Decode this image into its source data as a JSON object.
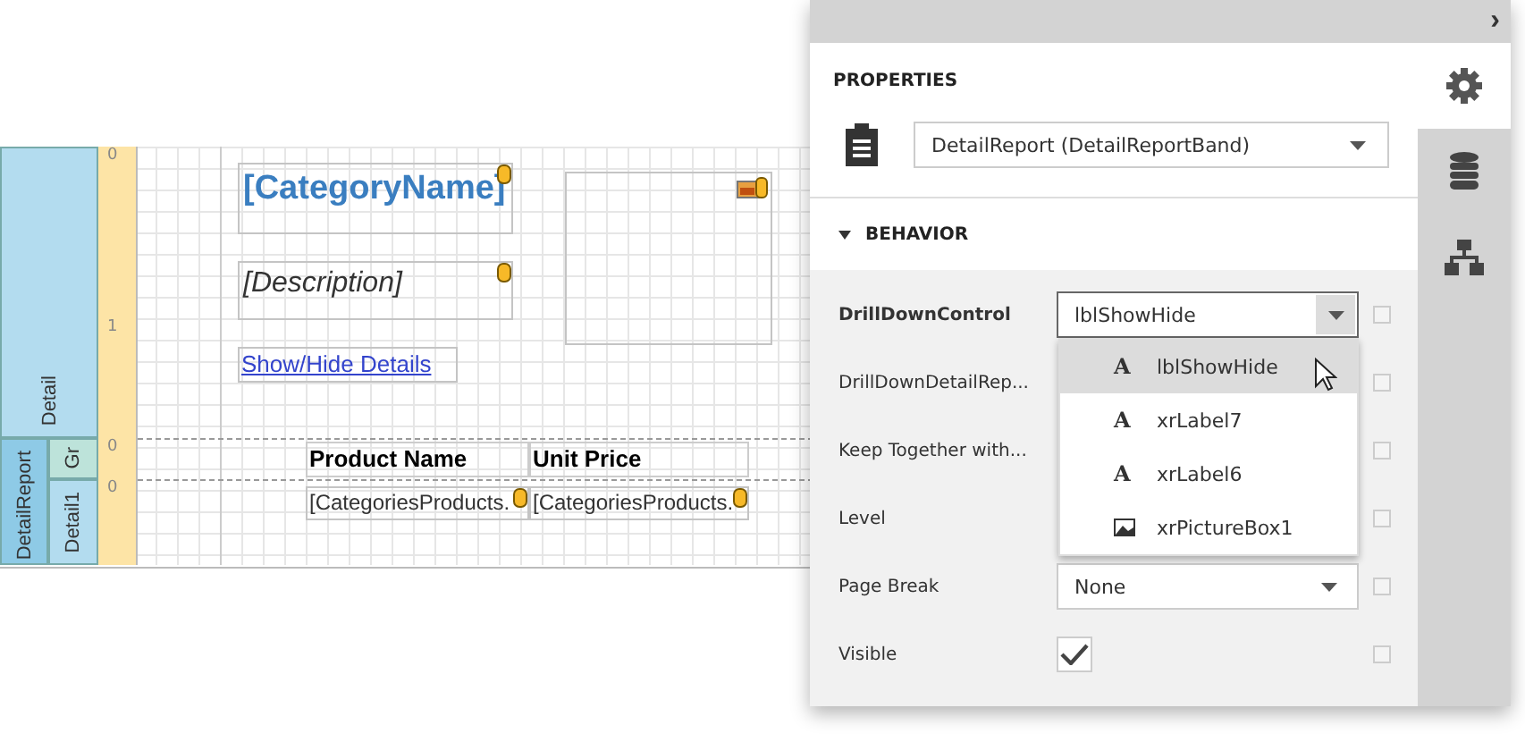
{
  "designer": {
    "bands": [
      {
        "label": "Detail",
        "kind": "detail"
      },
      {
        "label": "DetailReport",
        "kind": "report"
      },
      {
        "label": "Gr",
        "kind": "group"
      },
      {
        "label": "Detail1",
        "kind": "detail1"
      }
    ],
    "ruler_marks": [
      "0",
      "1",
      "0",
      "0"
    ],
    "controls": [
      {
        "kind": "title",
        "text": "[CategoryName]",
        "bound": true
      },
      {
        "kind": "italic",
        "text": "[Description]",
        "bound": true
      },
      {
        "kind": "link",
        "text": "Show/Hide Details",
        "bound": false
      },
      {
        "kind": "picture",
        "bound": true
      },
      {
        "kind": "header",
        "text": "Product Name",
        "bound": false
      },
      {
        "kind": "header",
        "text": "Unit Price",
        "bound": false
      },
      {
        "kind": "cell",
        "text": "[CategoriesProducts.",
        "bound": true
      },
      {
        "kind": "cell",
        "text": "[CategoriesProducts.",
        "bound": true
      }
    ]
  },
  "panel": {
    "collapse_glyph": "›",
    "title": "PROPERTIES",
    "object_selector": "DetailReport (DetailReportBand)",
    "tabs": [
      {
        "kind": "properties",
        "selected": true
      },
      {
        "kind": "data",
        "selected": false
      },
      {
        "kind": "structure",
        "selected": false
      }
    ],
    "section": {
      "title": "BEHAVIOR",
      "expanded": true
    },
    "properties": [
      {
        "name": "DrillDownControl",
        "modified": true,
        "kind": "combo",
        "value": "lblShowHide",
        "open": true,
        "reset_checked": false
      },
      {
        "name": "DrillDownDetailRep...",
        "modified": false,
        "kind": "covered",
        "reset_checked": false
      },
      {
        "name": "Keep Together with...",
        "modified": false,
        "kind": "covered",
        "reset_checked": false
      },
      {
        "name": "Level",
        "modified": false,
        "kind": "covered",
        "reset_checked": false
      },
      {
        "name": "Page Break",
        "modified": false,
        "kind": "combo",
        "value": "None",
        "open": false,
        "reset_checked": false
      },
      {
        "name": "Visible",
        "modified": false,
        "kind": "check",
        "checked": true,
        "reset_checked": false
      }
    ],
    "dropdown": [
      {
        "label": "lblShowHide",
        "kind": "label",
        "glyph": "A",
        "selected": true
      },
      {
        "label": "xrLabel7",
        "kind": "label",
        "glyph": "A",
        "selected": false
      },
      {
        "label": "xrLabel6",
        "kind": "label",
        "glyph": "A",
        "selected": false
      },
      {
        "label": "xrPictureBox1",
        "kind": "picture",
        "selected": false
      }
    ]
  }
}
